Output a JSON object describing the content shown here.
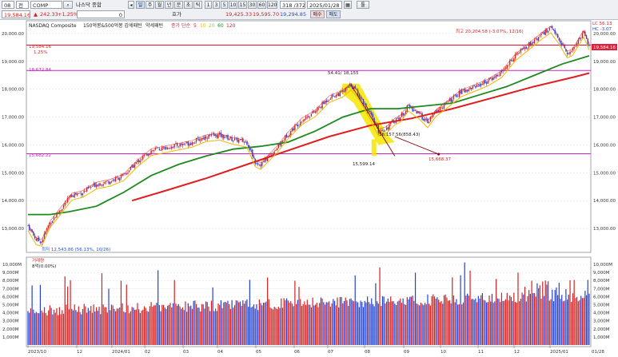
{
  "toolbar": {
    "screen_no": "08",
    "market": "전",
    "code": "COMP",
    "index_name": "나스닥 종합",
    "price": "19,584.16",
    "change": "242.33",
    "change_pct": "+1.25%",
    "volume": "0",
    "period_buttons": [
      "일",
      "주",
      "월",
      "년",
      "분",
      "초",
      "틱"
    ],
    "minute_buttons": [
      "1",
      "3",
      "5",
      "10",
      "15",
      "30",
      "60",
      "120"
    ],
    "counter": "318 /372",
    "date": "2025/01/28",
    "quote_label": "호가",
    "high_label": "19,425.33",
    "high2_label": "19,595.70",
    "low_label": "19,294.85",
    "buy_button": "매수",
    "sell_button": "매도",
    "extra_button": "툴"
  },
  "legend": {
    "title": "NASDAQ Composite",
    "sub1": "150억봉&500억봉 감세패턴",
    "sub2": "약세패턴",
    "ma_label": "종가 단순",
    "ma": [
      {
        "period": "5",
        "color": "#e11d1d"
      },
      {
        "period": "10",
        "color": "#f2b600"
      },
      {
        "period": "20",
        "color": "#9bcf2a"
      },
      {
        "period": "60",
        "color": "#1f8f1f"
      },
      {
        "period": "120",
        "color": "#e11d1d"
      }
    ]
  },
  "annotations": {
    "max_label": "최고 20,204.58 (-3.07%, 12/16)",
    "min_label": "최저 12,543.86 (56.13%, 10/26)",
    "peak_label": "54.41/ 18,155",
    "mid_label": "16,157.56(858.43)",
    "trough_label": "15,599.14",
    "target_label": "15,668.37",
    "level_top": "19,584.16",
    "level_top_pct": "1.25%",
    "level_mid": "18,672.84",
    "level_low": "15,682.22",
    "right_top1": "LC 56.13",
    "right_top2": "HC -3.07",
    "price_tag": "19,584.16"
  },
  "volume_panel": {
    "label": "거래량",
    "sub": "8억(0.00%)"
  },
  "colors": {
    "up": "#d32222",
    "down": "#2442d6",
    "ma60": "#1d8a1d",
    "ma120": "#e11d1d",
    "level_red": "#e0203a",
    "level_magenta": "#cc22cc",
    "highlight": "#f5e600"
  },
  "chart_data": {
    "type": "candlestick",
    "title": "NASDAQ Composite",
    "y_axis_labels": [
      "20,000.00",
      "19,000.00",
      "18,000.00",
      "17,000.00",
      "16,000.00",
      "15,000.00",
      "14,000.00",
      "13,000.00"
    ],
    "ylim": [
      12200,
      20400
    ],
    "x_axis_labels": [
      "2023/10",
      "12",
      "2024/01",
      "02",
      "03",
      "04",
      "05",
      "06",
      "07",
      "08",
      "09",
      "10",
      "11",
      "12",
      "2025/01",
      "01/28"
    ],
    "volume_axis_labels": [
      "10,000M",
      "9,000M",
      "8,000M",
      "7,000M",
      "6,000M",
      "5,000M",
      "4,000M",
      "3,000M",
      "2,000M",
      "1,000M"
    ],
    "volume_ylim": [
      0,
      10500
    ],
    "close_path": [
      [
        0,
        13100
      ],
      [
        6,
        12600
      ],
      [
        10,
        12543
      ],
      [
        16,
        13200
      ],
      [
        24,
        13700
      ],
      [
        32,
        14200
      ],
      [
        40,
        14300
      ],
      [
        50,
        14600
      ],
      [
        60,
        14700
      ],
      [
        70,
        14900
      ],
      [
        80,
        15400
      ],
      [
        90,
        15800
      ],
      [
        100,
        15900
      ],
      [
        110,
        16000
      ],
      [
        120,
        16100
      ],
      [
        130,
        16300
      ],
      [
        140,
        16350
      ],
      [
        150,
        16200
      ],
      [
        160,
        16100
      ],
      [
        166,
        15400
      ],
      [
        170,
        15300
      ],
      [
        176,
        15600
      ],
      [
        182,
        15900
      ],
      [
        190,
        16400
      ],
      [
        200,
        16900
      ],
      [
        210,
        17200
      ],
      [
        220,
        17700
      ],
      [
        230,
        17900
      ],
      [
        236,
        18155
      ],
      [
        242,
        17800
      ],
      [
        250,
        17100
      ],
      [
        256,
        16500
      ],
      [
        262,
        16600
      ],
      [
        268,
        16900
      ],
      [
        272,
        17000
      ],
      [
        278,
        17400
      ],
      [
        286,
        17100
      ],
      [
        292,
        16800
      ],
      [
        298,
        17200
      ],
      [
        306,
        17500
      ],
      [
        316,
        17900
      ],
      [
        326,
        18100
      ],
      [
        336,
        18300
      ],
      [
        346,
        18600
      ],
      [
        356,
        19200
      ],
      [
        366,
        19600
      ],
      [
        376,
        20000
      ],
      [
        382,
        20204
      ],
      [
        388,
        19800
      ],
      [
        394,
        19300
      ],
      [
        398,
        19400
      ],
      [
        404,
        19900
      ],
      [
        406,
        20050
      ],
      [
        410,
        19584
      ]
    ],
    "ma60_path": [
      [
        0,
        13500
      ],
      [
        16,
        13500
      ],
      [
        30,
        13600
      ],
      [
        50,
        13800
      ],
      [
        70,
        14300
      ],
      [
        90,
        14900
      ],
      [
        110,
        15300
      ],
      [
        130,
        15600
      ],
      [
        150,
        15850
      ],
      [
        170,
        15950
      ],
      [
        190,
        16100
      ],
      [
        210,
        16500
      ],
      [
        230,
        17000
      ],
      [
        250,
        17300
      ],
      [
        270,
        17300
      ],
      [
        290,
        17400
      ],
      [
        310,
        17500
      ],
      [
        330,
        17800
      ],
      [
        350,
        18100
      ],
      [
        370,
        18500
      ],
      [
        390,
        18900
      ],
      [
        410,
        19200
      ]
    ],
    "ma120_path": [
      [
        76,
        14000
      ],
      [
        100,
        14350
      ],
      [
        130,
        14800
      ],
      [
        160,
        15300
      ],
      [
        190,
        15800
      ],
      [
        220,
        16300
      ],
      [
        250,
        16700
      ],
      [
        280,
        16950
      ],
      [
        310,
        17300
      ],
      [
        340,
        17700
      ],
      [
        370,
        18100
      ],
      [
        400,
        18450
      ],
      [
        410,
        18580
      ]
    ]
  }
}
